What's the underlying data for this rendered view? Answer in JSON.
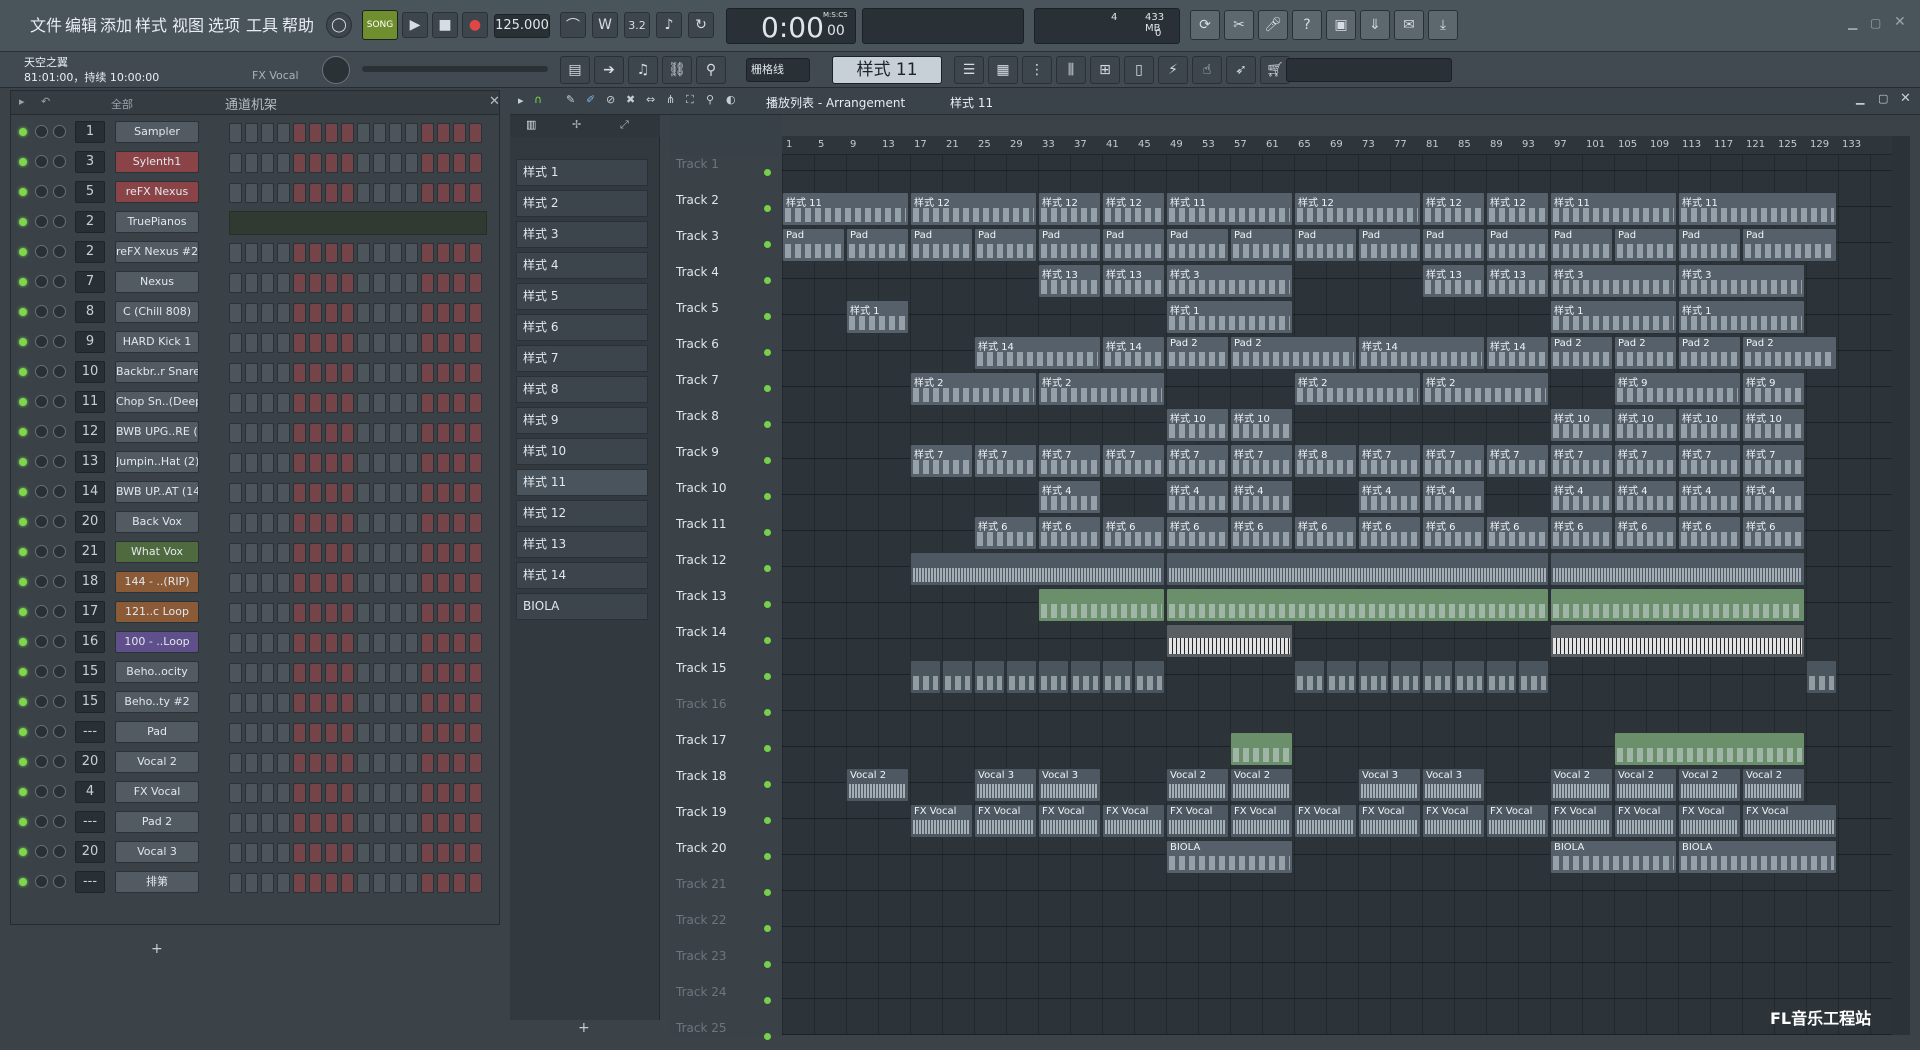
{
  "menu": [
    "文件",
    "编辑",
    "添加",
    "样式",
    "视图",
    "选项",
    "工具",
    "帮助"
  ],
  "transport": {
    "mode": "SONG",
    "tempo": "125.000",
    "time": "0:00",
    "time_small": "00",
    "time_label": "M:S:CS",
    "cpu": "4",
    "mem": "433 MB",
    "poly": "0"
  },
  "hint": {
    "title": "天空之翼",
    "line": "81:01:00，持续 10:00:00",
    "target": "FX Vocal"
  },
  "toolbar2": {
    "snap": "栅格线",
    "pattern": "样式 11"
  },
  "rack": {
    "filter": "全部",
    "title": "通道机架",
    "add": "+",
    "channels": [
      {
        "num": "1",
        "name": "Sampler",
        "color": "gray"
      },
      {
        "num": "3",
        "name": "Sylenth1",
        "color": "red"
      },
      {
        "num": "5",
        "name": "reFX Nexus",
        "color": "red"
      },
      {
        "num": "2",
        "name": "TruePianos",
        "color": "gray"
      },
      {
        "num": "2",
        "name": "reFX Nexus #2",
        "color": "gray"
      },
      {
        "num": "7",
        "name": "Nexus",
        "color": "gray"
      },
      {
        "num": "8",
        "name": "C (Chill 808)",
        "color": "gray"
      },
      {
        "num": "9",
        "name": "HARD Kick 1",
        "color": "gray"
      },
      {
        "num": "10",
        "name": "Backbr..r Snare",
        "color": "gray"
      },
      {
        "num": "11",
        "name": "Chop Sn..(Deep)",
        "color": "gray"
      },
      {
        "num": "12",
        "name": "BWB UPG..RE (3)",
        "color": "gray"
      },
      {
        "num": "13",
        "name": "Jumpin..Hat (2)",
        "color": "gray"
      },
      {
        "num": "14",
        "name": "BWB UP..AT (14)",
        "color": "gray"
      },
      {
        "num": "20",
        "name": "Back Vox",
        "color": "gray"
      },
      {
        "num": "21",
        "name": "What Vox",
        "color": "green"
      },
      {
        "num": "18",
        "name": "144 - ..(RIP)",
        "color": "orange"
      },
      {
        "num": "17",
        "name": "121..c Loop",
        "color": "orange"
      },
      {
        "num": "16",
        "name": "100 - ..Loop",
        "color": "purple"
      },
      {
        "num": "15",
        "name": "Beho..ocity",
        "color": "gray"
      },
      {
        "num": "15",
        "name": "Beho..ty #2",
        "color": "gray"
      },
      {
        "num": "---",
        "name": "Pad",
        "color": "gray"
      },
      {
        "num": "20",
        "name": "Vocal 2",
        "color": "gray"
      },
      {
        "num": "4",
        "name": "FX Vocal",
        "color": "gray"
      },
      {
        "num": "---",
        "name": "Pad 2",
        "color": "gray"
      },
      {
        "num": "20",
        "name": "Vocal 3",
        "color": "gray"
      },
      {
        "num": "---",
        "name": "排第",
        "color": "gray"
      }
    ]
  },
  "playlist": {
    "title": "播放列表 - Arrangement",
    "current": "样式 11",
    "add": "+"
  },
  "patterns": [
    "样式 1",
    "样式 2",
    "样式 3",
    "样式 4",
    "样式 5",
    "样式 6",
    "样式 7",
    "样式 8",
    "样式 9",
    "样式 10",
    "样式 11",
    "样式 12",
    "样式 13",
    "样式 14",
    "BIOLA"
  ],
  "tracks": [
    "Track 1",
    "Track 2",
    "Track 3",
    "Track 4",
    "Track 5",
    "Track 6",
    "Track 7",
    "Track 8",
    "Track 9",
    "Track 10",
    "Track 11",
    "Track 12",
    "Track 13",
    "Track 14",
    "Track 15",
    "Track 16",
    "Track 17",
    "Track 18",
    "Track 19",
    "Track 20",
    "Track 21",
    "Track 22",
    "Track 23",
    "Track 24",
    "Track 25"
  ],
  "ruler": [
    "1",
    "5",
    "9",
    "13",
    "17",
    "21",
    "25",
    "29",
    "33",
    "37",
    "41",
    "45",
    "49",
    "53",
    "57",
    "61",
    "65",
    "69",
    "73",
    "77",
    "81",
    "85",
    "89",
    "93",
    "97",
    "101",
    "105",
    "109",
    "113",
    "117",
    "121",
    "125",
    "129",
    "133"
  ],
  "clips": [
    {
      "t": 2,
      "s": 0,
      "e": 4,
      "l": "样式 11"
    },
    {
      "t": 2,
      "s": 4,
      "e": 8,
      "l": "样式 12"
    },
    {
      "t": 2,
      "s": 8,
      "e": 10,
      "l": "样式 12"
    },
    {
      "t": 2,
      "s": 10,
      "e": 12,
      "l": "样式 12"
    },
    {
      "t": 2,
      "s": 12,
      "e": 16,
      "l": "样式 11"
    },
    {
      "t": 2,
      "s": 16,
      "e": 20,
      "l": "样式 12"
    },
    {
      "t": 2,
      "s": 20,
      "e": 22,
      "l": "样式 12"
    },
    {
      "t": 2,
      "s": 22,
      "e": 24,
      "l": "样式 12"
    },
    {
      "t": 2,
      "s": 24,
      "e": 28,
      "l": "样式 11"
    },
    {
      "t": 2,
      "s": 28,
      "e": 33,
      "l": "样式 11"
    },
    {
      "t": 3,
      "s": 0,
      "e": 2,
      "l": "Pad"
    },
    {
      "t": 3,
      "s": 2,
      "e": 4,
      "l": "Pad"
    },
    {
      "t": 3,
      "s": 4,
      "e": 6,
      "l": "Pad"
    },
    {
      "t": 3,
      "s": 6,
      "e": 8,
      "l": "Pad"
    },
    {
      "t": 3,
      "s": 8,
      "e": 10,
      "l": "Pad"
    },
    {
      "t": 3,
      "s": 10,
      "e": 12,
      "l": "Pad"
    },
    {
      "t": 3,
      "s": 12,
      "e": 14,
      "l": "Pad"
    },
    {
      "t": 3,
      "s": 14,
      "e": 16,
      "l": "Pad"
    },
    {
      "t": 3,
      "s": 16,
      "e": 18,
      "l": "Pad"
    },
    {
      "t": 3,
      "s": 18,
      "e": 20,
      "l": "Pad"
    },
    {
      "t": 3,
      "s": 20,
      "e": 22,
      "l": "Pad"
    },
    {
      "t": 3,
      "s": 22,
      "e": 24,
      "l": "Pad"
    },
    {
      "t": 3,
      "s": 24,
      "e": 26,
      "l": "Pad"
    },
    {
      "t": 3,
      "s": 26,
      "e": 28,
      "l": "Pad"
    },
    {
      "t": 3,
      "s": 28,
      "e": 30,
      "l": "Pad"
    },
    {
      "t": 3,
      "s": 30,
      "e": 33,
      "l": "Pad"
    },
    {
      "t": 4,
      "s": 8,
      "e": 10,
      "l": "样式 13"
    },
    {
      "t": 4,
      "s": 10,
      "e": 12,
      "l": "样式 13"
    },
    {
      "t": 4,
      "s": 12,
      "e": 16,
      "l": "样式 3"
    },
    {
      "t": 4,
      "s": 20,
      "e": 22,
      "l": "样式 13"
    },
    {
      "t": 4,
      "s": 22,
      "e": 24,
      "l": "样式 13"
    },
    {
      "t": 4,
      "s": 24,
      "e": 28,
      "l": "样式 3"
    },
    {
      "t": 4,
      "s": 28,
      "e": 32,
      "l": "样式 3"
    },
    {
      "t": 5,
      "s": 2,
      "e": 4,
      "l": "样式 1"
    },
    {
      "t": 5,
      "s": 12,
      "e": 16,
      "l": "样式 1"
    },
    {
      "t": 5,
      "s": 24,
      "e": 28,
      "l": "样式 1"
    },
    {
      "t": 5,
      "s": 28,
      "e": 32,
      "l": "样式 1"
    },
    {
      "t": 6,
      "s": 6,
      "e": 10,
      "l": "样式 14"
    },
    {
      "t": 6,
      "s": 10,
      "e": 12,
      "l": "样式 14"
    },
    {
      "t": 6,
      "s": 12,
      "e": 14,
      "l": "Pad 2"
    },
    {
      "t": 6,
      "s": 14,
      "e": 18,
      "l": "Pad 2"
    },
    {
      "t": 6,
      "s": 18,
      "e": 22,
      "l": "样式 14"
    },
    {
      "t": 6,
      "s": 22,
      "e": 24,
      "l": "样式 14"
    },
    {
      "t": 6,
      "s": 24,
      "e": 26,
      "l": "Pad 2"
    },
    {
      "t": 6,
      "s": 26,
      "e": 28,
      "l": "Pad 2"
    },
    {
      "t": 6,
      "s": 28,
      "e": 30,
      "l": "Pad 2"
    },
    {
      "t": 6,
      "s": 30,
      "e": 33,
      "l": "Pad 2"
    },
    {
      "t": 7,
      "s": 4,
      "e": 8,
      "l": "样式 2"
    },
    {
      "t": 7,
      "s": 8,
      "e": 12,
      "l": "样式 2"
    },
    {
      "t": 7,
      "s": 16,
      "e": 20,
      "l": "样式 2"
    },
    {
      "t": 7,
      "s": 20,
      "e": 24,
      "l": "样式 2"
    },
    {
      "t": 7,
      "s": 26,
      "e": 30,
      "l": "样式 9"
    },
    {
      "t": 7,
      "s": 30,
      "e": 32,
      "l": "样式 9"
    },
    {
      "t": 8,
      "s": 12,
      "e": 14,
      "l": "样式 10"
    },
    {
      "t": 8,
      "s": 14,
      "e": 16,
      "l": "样式 10"
    },
    {
      "t": 8,
      "s": 24,
      "e": 26,
      "l": "样式 10"
    },
    {
      "t": 8,
      "s": 26,
      "e": 28,
      "l": "样式 10"
    },
    {
      "t": 8,
      "s": 28,
      "e": 30,
      "l": "样式 10"
    },
    {
      "t": 8,
      "s": 30,
      "e": 32,
      "l": "样式 10"
    },
    {
      "t": 9,
      "s": 4,
      "e": 6,
      "l": "样式 7"
    },
    {
      "t": 9,
      "s": 6,
      "e": 8,
      "l": "样式 7"
    },
    {
      "t": 9,
      "s": 8,
      "e": 10,
      "l": "样式 7"
    },
    {
      "t": 9,
      "s": 10,
      "e": 12,
      "l": "样式 7"
    },
    {
      "t": 9,
      "s": 12,
      "e": 14,
      "l": "样式 7"
    },
    {
      "t": 9,
      "s": 14,
      "e": 16,
      "l": "样式 7"
    },
    {
      "t": 9,
      "s": 16,
      "e": 18,
      "l": "样式 8"
    },
    {
      "t": 9,
      "s": 18,
      "e": 20,
      "l": "样式 7"
    },
    {
      "t": 9,
      "s": 20,
      "e": 22,
      "l": "样式 7"
    },
    {
      "t": 9,
      "s": 22,
      "e": 24,
      "l": "样式 7"
    },
    {
      "t": 9,
      "s": 24,
      "e": 26,
      "l": "样式 7"
    },
    {
      "t": 9,
      "s": 26,
      "e": 28,
      "l": "样式 7"
    },
    {
      "t": 9,
      "s": 28,
      "e": 30,
      "l": "样式 7"
    },
    {
      "t": 9,
      "s": 30,
      "e": 32,
      "l": "样式 7"
    },
    {
      "t": 10,
      "s": 8,
      "e": 10,
      "l": "样式 4"
    },
    {
      "t": 10,
      "s": 12,
      "e": 14,
      "l": "样式 4"
    },
    {
      "t": 10,
      "s": 14,
      "e": 16,
      "l": "样式 4"
    },
    {
      "t": 10,
      "s": 18,
      "e": 20,
      "l": "样式 4"
    },
    {
      "t": 10,
      "s": 20,
      "e": 22,
      "l": "样式 4"
    },
    {
      "t": 10,
      "s": 24,
      "e": 26,
      "l": "样式 4"
    },
    {
      "t": 10,
      "s": 26,
      "e": 28,
      "l": "样式 4"
    },
    {
      "t": 10,
      "s": 28,
      "e": 30,
      "l": "样式 4"
    },
    {
      "t": 10,
      "s": 30,
      "e": 32,
      "l": "样式 4"
    },
    {
      "t": 11,
      "s": 6,
      "e": 8,
      "l": "样式 6"
    },
    {
      "t": 11,
      "s": 8,
      "e": 10,
      "l": "样式 6"
    },
    {
      "t": 11,
      "s": 10,
      "e": 12,
      "l": "样式 6"
    },
    {
      "t": 11,
      "s": 12,
      "e": 14,
      "l": "样式 6"
    },
    {
      "t": 11,
      "s": 14,
      "e": 16,
      "l": "样式 6"
    },
    {
      "t": 11,
      "s": 16,
      "e": 18,
      "l": "样式 6"
    },
    {
      "t": 11,
      "s": 18,
      "e": 20,
      "l": "样式 6"
    },
    {
      "t": 11,
      "s": 20,
      "e": 22,
      "l": "样式 6"
    },
    {
      "t": 11,
      "s": 22,
      "e": 24,
      "l": "样式 6"
    },
    {
      "t": 11,
      "s": 24,
      "e": 26,
      "l": "样式 6"
    },
    {
      "t": 11,
      "s": 26,
      "e": 28,
      "l": "样式 6"
    },
    {
      "t": 11,
      "s": 28,
      "e": 30,
      "l": "样式 6"
    },
    {
      "t": 11,
      "s": 30,
      "e": 32,
      "l": "样式 6"
    },
    {
      "t": 12,
      "s": 4,
      "e": 12,
      "l": "",
      "k": "audio"
    },
    {
      "t": 12,
      "s": 12,
      "e": 24,
      "l": "",
      "k": "audio"
    },
    {
      "t": 12,
      "s": 24,
      "e": 32,
      "l": "",
      "k": "audio"
    },
    {
      "t": 13,
      "s": 8,
      "e": 12,
      "l": "",
      "k": "green"
    },
    {
      "t": 13,
      "s": 12,
      "e": 24,
      "l": "",
      "k": "green"
    },
    {
      "t": 13,
      "s": 24,
      "e": 32,
      "l": "",
      "k": "green"
    },
    {
      "t": 14,
      "s": 12,
      "e": 16,
      "l": "",
      "k": "piano"
    },
    {
      "t": 14,
      "s": 24,
      "e": 32,
      "l": "",
      "k": "piano"
    },
    {
      "t": 15,
      "s": 4,
      "e": 5,
      "l": "",
      "k": "mark"
    },
    {
      "t": 15,
      "s": 5,
      "e": 6,
      "l": "",
      "k": "mark"
    },
    {
      "t": 15,
      "s": 6,
      "e": 7,
      "l": "",
      "k": "mark"
    },
    {
      "t": 15,
      "s": 7,
      "e": 8,
      "l": "",
      "k": "mark"
    },
    {
      "t": 15,
      "s": 8,
      "e": 9,
      "l": "",
      "k": "mark"
    },
    {
      "t": 15,
      "s": 9,
      "e": 10,
      "l": "",
      "k": "mark"
    },
    {
      "t": 15,
      "s": 10,
      "e": 11,
      "l": "",
      "k": "mark"
    },
    {
      "t": 15,
      "s": 11,
      "e": 12,
      "l": "",
      "k": "mark"
    },
    {
      "t": 15,
      "s": 16,
      "e": 17,
      "l": "",
      "k": "mark"
    },
    {
      "t": 15,
      "s": 17,
      "e": 18,
      "l": "",
      "k": "mark"
    },
    {
      "t": 15,
      "s": 18,
      "e": 19,
      "l": "",
      "k": "mark"
    },
    {
      "t": 15,
      "s": 19,
      "e": 20,
      "l": "",
      "k": "mark"
    },
    {
      "t": 15,
      "s": 20,
      "e": 21,
      "l": "",
      "k": "mark"
    },
    {
      "t": 15,
      "s": 21,
      "e": 22,
      "l": "",
      "k": "mark"
    },
    {
      "t": 15,
      "s": 22,
      "e": 23,
      "l": "",
      "k": "mark"
    },
    {
      "t": 15,
      "s": 23,
      "e": 24,
      "l": "",
      "k": "mark"
    },
    {
      "t": 15,
      "s": 32,
      "e": 33,
      "l": "",
      "k": "mark"
    },
    {
      "t": 17,
      "s": 14,
      "e": 16,
      "l": "",
      "k": "green"
    },
    {
      "t": 17,
      "s": 26,
      "e": 32,
      "l": "",
      "k": "green"
    },
    {
      "t": 18,
      "s": 2,
      "e": 4,
      "l": "Vocal 2",
      "k": "audio"
    },
    {
      "t": 18,
      "s": 6,
      "e": 8,
      "l": "Vocal 3",
      "k": "audio"
    },
    {
      "t": 18,
      "s": 8,
      "e": 10,
      "l": "Vocal 3",
      "k": "audio"
    },
    {
      "t": 18,
      "s": 12,
      "e": 14,
      "l": "Vocal 2",
      "k": "audio"
    },
    {
      "t": 18,
      "s": 14,
      "e": 16,
      "l": "Vocal 2",
      "k": "audio"
    },
    {
      "t": 18,
      "s": 18,
      "e": 20,
      "l": "Vocal 3",
      "k": "audio"
    },
    {
      "t": 18,
      "s": 20,
      "e": 22,
      "l": "Vocal 3",
      "k": "audio"
    },
    {
      "t": 18,
      "s": 24,
      "e": 26,
      "l": "Vocal 2",
      "k": "audio"
    },
    {
      "t": 18,
      "s": 26,
      "e": 28,
      "l": "Vocal 2",
      "k": "audio"
    },
    {
      "t": 18,
      "s": 28,
      "e": 30,
      "l": "Vocal 2",
      "k": "audio"
    },
    {
      "t": 18,
      "s": 30,
      "e": 32,
      "l": "Vocal 2",
      "k": "audio"
    },
    {
      "t": 19,
      "s": 4,
      "e": 6,
      "l": "FX Vocal",
      "k": "audio"
    },
    {
      "t": 19,
      "s": 6,
      "e": 8,
      "l": "FX Vocal",
      "k": "audio"
    },
    {
      "t": 19,
      "s": 8,
      "e": 10,
      "l": "FX Vocal",
      "k": "audio"
    },
    {
      "t": 19,
      "s": 10,
      "e": 12,
      "l": "FX Vocal",
      "k": "audio"
    },
    {
      "t": 19,
      "s": 12,
      "e": 14,
      "l": "FX Vocal",
      "k": "audio"
    },
    {
      "t": 19,
      "s": 14,
      "e": 16,
      "l": "FX Vocal",
      "k": "audio"
    },
    {
      "t": 19,
      "s": 16,
      "e": 18,
      "l": "FX Vocal",
      "k": "audio"
    },
    {
      "t": 19,
      "s": 18,
      "e": 20,
      "l": "FX Vocal",
      "k": "audio"
    },
    {
      "t": 19,
      "s": 20,
      "e": 22,
      "l": "FX Vocal",
      "k": "audio"
    },
    {
      "t": 19,
      "s": 22,
      "e": 24,
      "l": "FX Vocal",
      "k": "audio"
    },
    {
      "t": 19,
      "s": 24,
      "e": 26,
      "l": "FX Vocal",
      "k": "audio"
    },
    {
      "t": 19,
      "s": 26,
      "e": 28,
      "l": "FX Vocal",
      "k": "audio"
    },
    {
      "t": 19,
      "s": 28,
      "e": 30,
      "l": "FX Vocal",
      "k": "audio"
    },
    {
      "t": 19,
      "s": 30,
      "e": 33,
      "l": "FX Vocal",
      "k": "audio"
    },
    {
      "t": 20,
      "s": 12,
      "e": 16,
      "l": "BIOLA"
    },
    {
      "t": 20,
      "s": 24,
      "e": 28,
      "l": "BIOLA"
    },
    {
      "t": 20,
      "s": 28,
      "e": 33,
      "l": "BIOLA"
    }
  ],
  "watermark": "FL音乐工程站",
  "colors": {
    "accent": "#7fd64b",
    "clip": "#56606a",
    "record": "#e24545"
  }
}
